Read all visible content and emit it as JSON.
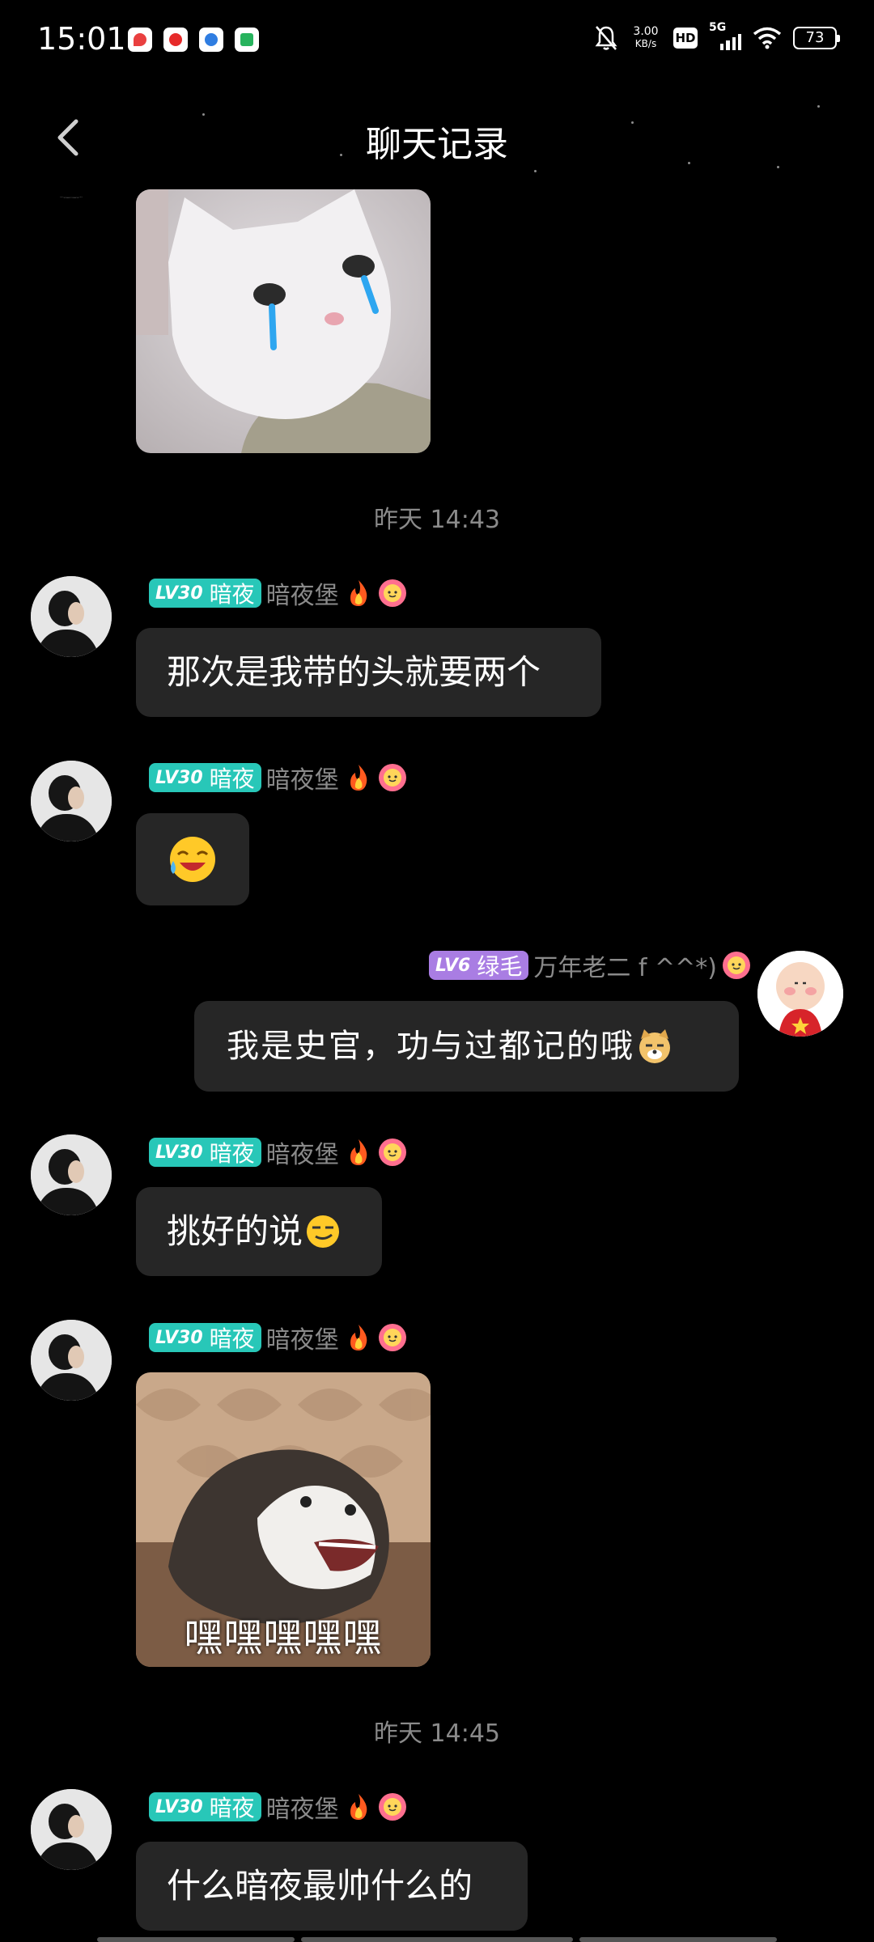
{
  "status_bar": {
    "time": "15:01",
    "net_speed_value": "3.00",
    "net_speed_unit": "KB/s",
    "hd_label": "HD",
    "network_label": "5G",
    "battery": "73"
  },
  "header": {
    "title": "聊天记录",
    "back_icon": "chevron-left-icon"
  },
  "timestamps": [
    "昨天 14:43",
    "昨天 14:45"
  ],
  "messages": [
    {
      "level": "LV30",
      "group": "暗夜",
      "nickname": "暗夜堡",
      "text": "那次是我带的头就要两个"
    },
    {
      "level": "LV30",
      "group": "暗夜",
      "nickname": "暗夜堡",
      "text": ""
    },
    {
      "level": "LV6",
      "group": "绿毛",
      "nickname": "万年老二 f ^^*)",
      "text": "我是史官，功与过都记的哦"
    },
    {
      "level": "LV30",
      "group": "暗夜",
      "nickname": "暗夜堡",
      "text": "挑好的说"
    },
    {
      "level": "LV30",
      "group": "暗夜",
      "nickname": "暗夜堡",
      "sticker_caption": "嘿嘿嘿嘿嘿"
    },
    {
      "level": "LV30",
      "group": "暗夜",
      "nickname": "暗夜堡",
      "text": "什么暗夜最帅什么的"
    }
  ],
  "colors": {
    "background": "#000000",
    "bubble": "#262626",
    "lv30_badge": "#28c7b8",
    "lv6_badge": "#a97de3",
    "nickname": "#8a8a8a"
  }
}
